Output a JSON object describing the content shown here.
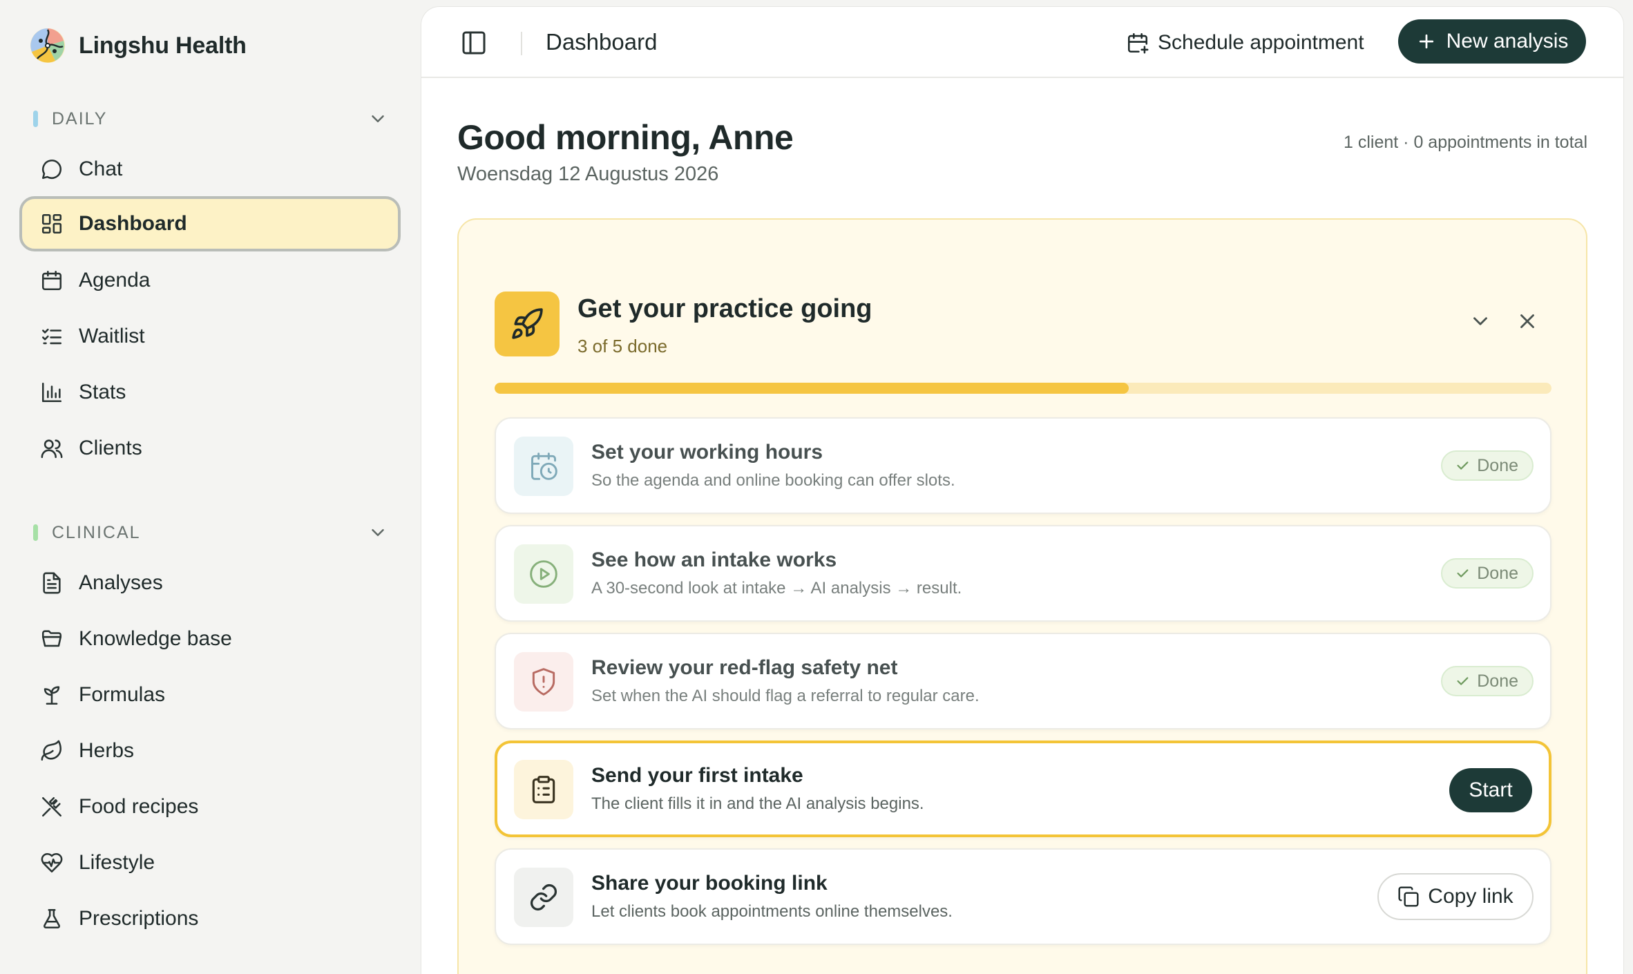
{
  "app": {
    "name": "Lingshu Health"
  },
  "sidebar": {
    "sections": [
      {
        "label": "DAILY",
        "accent": "#9ed3ea",
        "items": [
          {
            "label": "Chat",
            "icon": "chat-bubble-icon"
          },
          {
            "label": "Dashboard",
            "icon": "dashboard-grid-icon",
            "active": true
          },
          {
            "label": "Agenda",
            "icon": "calendar-icon"
          },
          {
            "label": "Waitlist",
            "icon": "checklist-icon"
          },
          {
            "label": "Stats",
            "icon": "bar-chart-icon"
          },
          {
            "label": "Clients",
            "icon": "users-icon"
          }
        ]
      },
      {
        "label": "CLINICAL",
        "accent": "#a6e0a6",
        "items": [
          {
            "label": "Analyses",
            "icon": "document-icon"
          },
          {
            "label": "Knowledge base",
            "icon": "folder-icon"
          },
          {
            "label": "Formulas",
            "icon": "sprout-icon"
          },
          {
            "label": "Herbs",
            "icon": "leaf-icon"
          },
          {
            "label": "Food recipes",
            "icon": "utensils-icon"
          },
          {
            "label": "Lifestyle",
            "icon": "heart-pulse-icon"
          },
          {
            "label": "Prescriptions",
            "icon": "flask-icon"
          }
        ]
      }
    ]
  },
  "topbar": {
    "title": "Dashboard",
    "schedule_label": "Schedule appointment",
    "new_analysis_label": "New analysis"
  },
  "greeting": {
    "title": "Good morning, Anne",
    "date": "Woensdag 12 Augustus 2026",
    "totals": "1 client · 0 appointments in total"
  },
  "onboarding": {
    "title": "Get your practice going",
    "progress_text": "3 of 5 done",
    "progress": 0.6,
    "tasks": [
      {
        "title": "Set your working hours",
        "subtitle": "So the agenda and online booking can offer slots.",
        "status": "done",
        "status_label": "Done",
        "icon": "calendar-clock-icon"
      },
      {
        "title": "See how an intake works",
        "subtitle": "A 30-second look at intake → AI analysis → result.",
        "status": "done",
        "status_label": "Done",
        "icon": "play-circle-icon"
      },
      {
        "title": "Review your red-flag safety net",
        "subtitle": "Set when the AI should flag a referral to regular care.",
        "status": "done",
        "status_label": "Done",
        "icon": "shield-alert-icon"
      },
      {
        "title": "Send your first intake",
        "subtitle": "The client fills it in and the AI analysis begins.",
        "status": "current",
        "action_label": "Start",
        "icon": "clipboard-list-icon"
      },
      {
        "title": "Share your booking link",
        "subtitle": "Let clients book appointments online themselves.",
        "status": "todo",
        "action_label": "Copy link",
        "icon": "link-icon"
      }
    ]
  },
  "colors": {
    "brand_dark": "#1d3a37",
    "accent_yellow": "#f5c542",
    "active_nav_bg": "#fdf2c6",
    "card_bg": "#fffaea"
  }
}
